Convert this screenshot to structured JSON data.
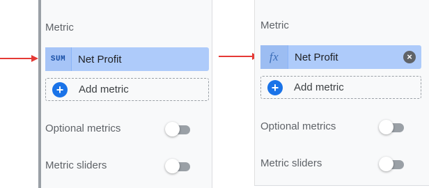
{
  "left_panel": {
    "section_title": "Metric",
    "metric_chip": {
      "aggregation": "SUM",
      "label": "Net Profit"
    },
    "add_metric_label": "Add metric",
    "options": [
      {
        "label": "Optional metrics",
        "enabled": false
      },
      {
        "label": "Metric sliders",
        "enabled": false
      }
    ]
  },
  "right_panel": {
    "section_title": "Metric",
    "metric_chip": {
      "aggregation": "fx",
      "label": "Net Profit",
      "remove_icon": "close-circle-icon"
    },
    "add_metric_label": "Add metric",
    "options": [
      {
        "label": "Optional metrics",
        "enabled": false
      },
      {
        "label": "Metric sliders",
        "enabled": false
      }
    ]
  },
  "colors": {
    "chip_bg": "#aecbfa",
    "accent": "#1a73e8",
    "arrow": "#e53935",
    "toggle_off": "#9aa0a6"
  }
}
